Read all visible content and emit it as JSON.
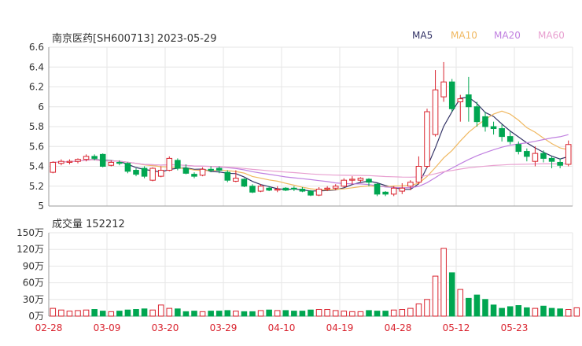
{
  "header": {
    "title_text": "南京医药[SH600713] 2023-05-29",
    "volume_text": "成交量 152212"
  },
  "legend": [
    {
      "name": "MA5",
      "color": "#333366"
    },
    {
      "name": "MA10",
      "color": "#f0b860"
    },
    {
      "name": "MA20",
      "color": "#c080e0"
    },
    {
      "name": "MA60",
      "color": "#e8a0d0"
    }
  ],
  "colors": {
    "up": "#d9232e",
    "down": "#00a651",
    "grid": "#e6e6e6",
    "axis": "#999999"
  },
  "chart_data": [
    {
      "type": "candlestick",
      "title": "南京医药[SH600713] 2023-05-29",
      "ylim": [
        5,
        6.6
      ],
      "yticks": [
        "5",
        "5.2",
        "5.4",
        "5.6",
        "5.8",
        "6",
        "6.2",
        "6.4",
        "6.6"
      ],
      "xticks": [
        {
          "label": "02-28",
          "index": 0
        },
        {
          "label": "03-09",
          "index": 7
        },
        {
          "label": "03-20",
          "index": 14
        },
        {
          "label": "03-29",
          "index": 21
        },
        {
          "label": "04-10",
          "index": 28
        },
        {
          "label": "04-19",
          "index": 35
        },
        {
          "label": "04-28",
          "index": 42
        },
        {
          "label": "05-12",
          "index": 49
        },
        {
          "label": "05-23",
          "index": 56
        }
      ],
      "candles": [
        [
          5.34,
          5.44,
          5.45,
          5.33
        ],
        [
          5.43,
          5.45,
          5.47,
          5.41
        ],
        [
          5.44,
          5.45,
          5.47,
          5.42
        ],
        [
          5.45,
          5.47,
          5.48,
          5.43
        ],
        [
          5.47,
          5.5,
          5.52,
          5.45
        ],
        [
          5.5,
          5.48,
          5.52,
          5.46
        ],
        [
          5.52,
          5.4,
          5.53,
          5.39
        ],
        [
          5.41,
          5.44,
          5.46,
          5.4
        ],
        [
          5.44,
          5.43,
          5.46,
          5.41
        ],
        [
          5.43,
          5.35,
          5.44,
          5.33
        ],
        [
          5.36,
          5.32,
          5.38,
          5.3
        ],
        [
          5.38,
          5.3,
          5.4,
          5.28
        ],
        [
          5.26,
          5.38,
          5.39,
          5.25
        ],
        [
          5.3,
          5.36,
          5.4,
          5.29
        ],
        [
          5.36,
          5.48,
          5.5,
          5.35
        ],
        [
          5.46,
          5.38,
          5.48,
          5.36
        ],
        [
          5.38,
          5.33,
          5.42,
          5.32
        ],
        [
          5.32,
          5.3,
          5.34,
          5.28
        ],
        [
          5.31,
          5.37,
          5.39,
          5.3
        ],
        [
          5.37,
          5.36,
          5.4,
          5.34
        ],
        [
          5.38,
          5.36,
          5.4,
          5.33
        ],
        [
          5.34,
          5.26,
          5.36,
          5.24
        ],
        [
          5.25,
          5.28,
          5.36,
          5.24
        ],
        [
          5.27,
          5.2,
          5.28,
          5.19
        ],
        [
          5.2,
          5.14,
          5.22,
          5.13
        ],
        [
          5.15,
          5.2,
          5.22,
          5.14
        ],
        [
          5.18,
          5.16,
          5.2,
          5.15
        ],
        [
          5.16,
          5.17,
          5.2,
          5.14
        ],
        [
          5.18,
          5.16,
          5.19,
          5.15
        ],
        [
          5.18,
          5.17,
          5.2,
          5.15
        ],
        [
          5.17,
          5.15,
          5.19,
          5.14
        ],
        [
          5.15,
          5.11,
          5.16,
          5.1
        ],
        [
          5.11,
          5.17,
          5.19,
          5.1
        ],
        [
          5.17,
          5.18,
          5.2,
          5.15
        ],
        [
          5.18,
          5.2,
          5.22,
          5.16
        ],
        [
          5.2,
          5.26,
          5.28,
          5.19
        ],
        [
          5.26,
          5.27,
          5.3,
          5.22
        ],
        [
          5.26,
          5.28,
          5.29,
          5.24
        ],
        [
          5.27,
          5.24,
          5.28,
          5.2
        ],
        [
          5.22,
          5.12,
          5.23,
          5.1
        ],
        [
          5.14,
          5.12,
          5.15,
          5.1
        ],
        [
          5.12,
          5.18,
          5.2,
          5.1
        ],
        [
          5.15,
          5.18,
          5.23,
          5.12
        ],
        [
          5.2,
          5.24,
          5.26,
          5.16
        ],
        [
          5.24,
          5.4,
          5.5,
          5.22
        ],
        [
          5.4,
          5.95,
          5.98,
          5.38
        ],
        [
          5.72,
          6.17,
          6.37,
          5.7
        ],
        [
          6.1,
          6.25,
          6.45,
          6.05
        ],
        [
          6.25,
          5.98,
          6.28,
          5.95
        ],
        [
          6.05,
          6.08,
          6.12,
          5.85
        ],
        [
          6.12,
          6.0,
          6.3,
          5.85
        ],
        [
          6.0,
          5.85,
          6.05,
          5.8
        ],
        [
          5.9,
          5.8,
          5.95,
          5.75
        ],
        [
          5.8,
          5.78,
          5.85,
          5.72
        ],
        [
          5.78,
          5.7,
          5.82,
          5.65
        ],
        [
          5.7,
          5.65,
          5.75,
          5.62
        ],
        [
          5.62,
          5.55,
          5.65,
          5.52
        ],
        [
          5.55,
          5.5,
          5.58,
          5.45
        ],
        [
          5.45,
          5.53,
          5.6,
          5.4
        ],
        [
          5.53,
          5.48,
          5.56,
          5.44
        ],
        [
          5.48,
          5.45,
          5.5,
          5.38
        ],
        [
          5.44,
          5.41,
          5.48,
          5.38
        ],
        [
          5.42,
          5.62,
          5.66,
          5.4
        ]
      ]
    },
    {
      "type": "bar",
      "title": "成交量 152212",
      "ylim": [
        0,
        150
      ],
      "yticks": [
        "0万",
        "30万",
        "60万",
        "90万",
        "120万",
        "150万"
      ],
      "values": [
        14,
        11,
        9,
        10,
        11,
        12,
        9,
        8,
        9,
        11,
        12,
        13,
        11,
        20,
        14,
        13,
        8,
        9,
        8,
        9,
        9,
        10,
        9,
        8,
        8,
        10,
        11,
        10,
        10,
        9,
        9,
        11,
        12,
        12,
        10,
        9,
        8,
        8,
        10,
        9,
        9,
        11,
        12,
        14,
        22,
        30,
        72,
        122,
        78,
        48,
        32,
        38,
        30,
        20,
        14,
        17,
        19,
        15,
        14,
        18,
        14,
        13,
        12,
        15,
        15,
        14,
        15
      ]
    }
  ]
}
